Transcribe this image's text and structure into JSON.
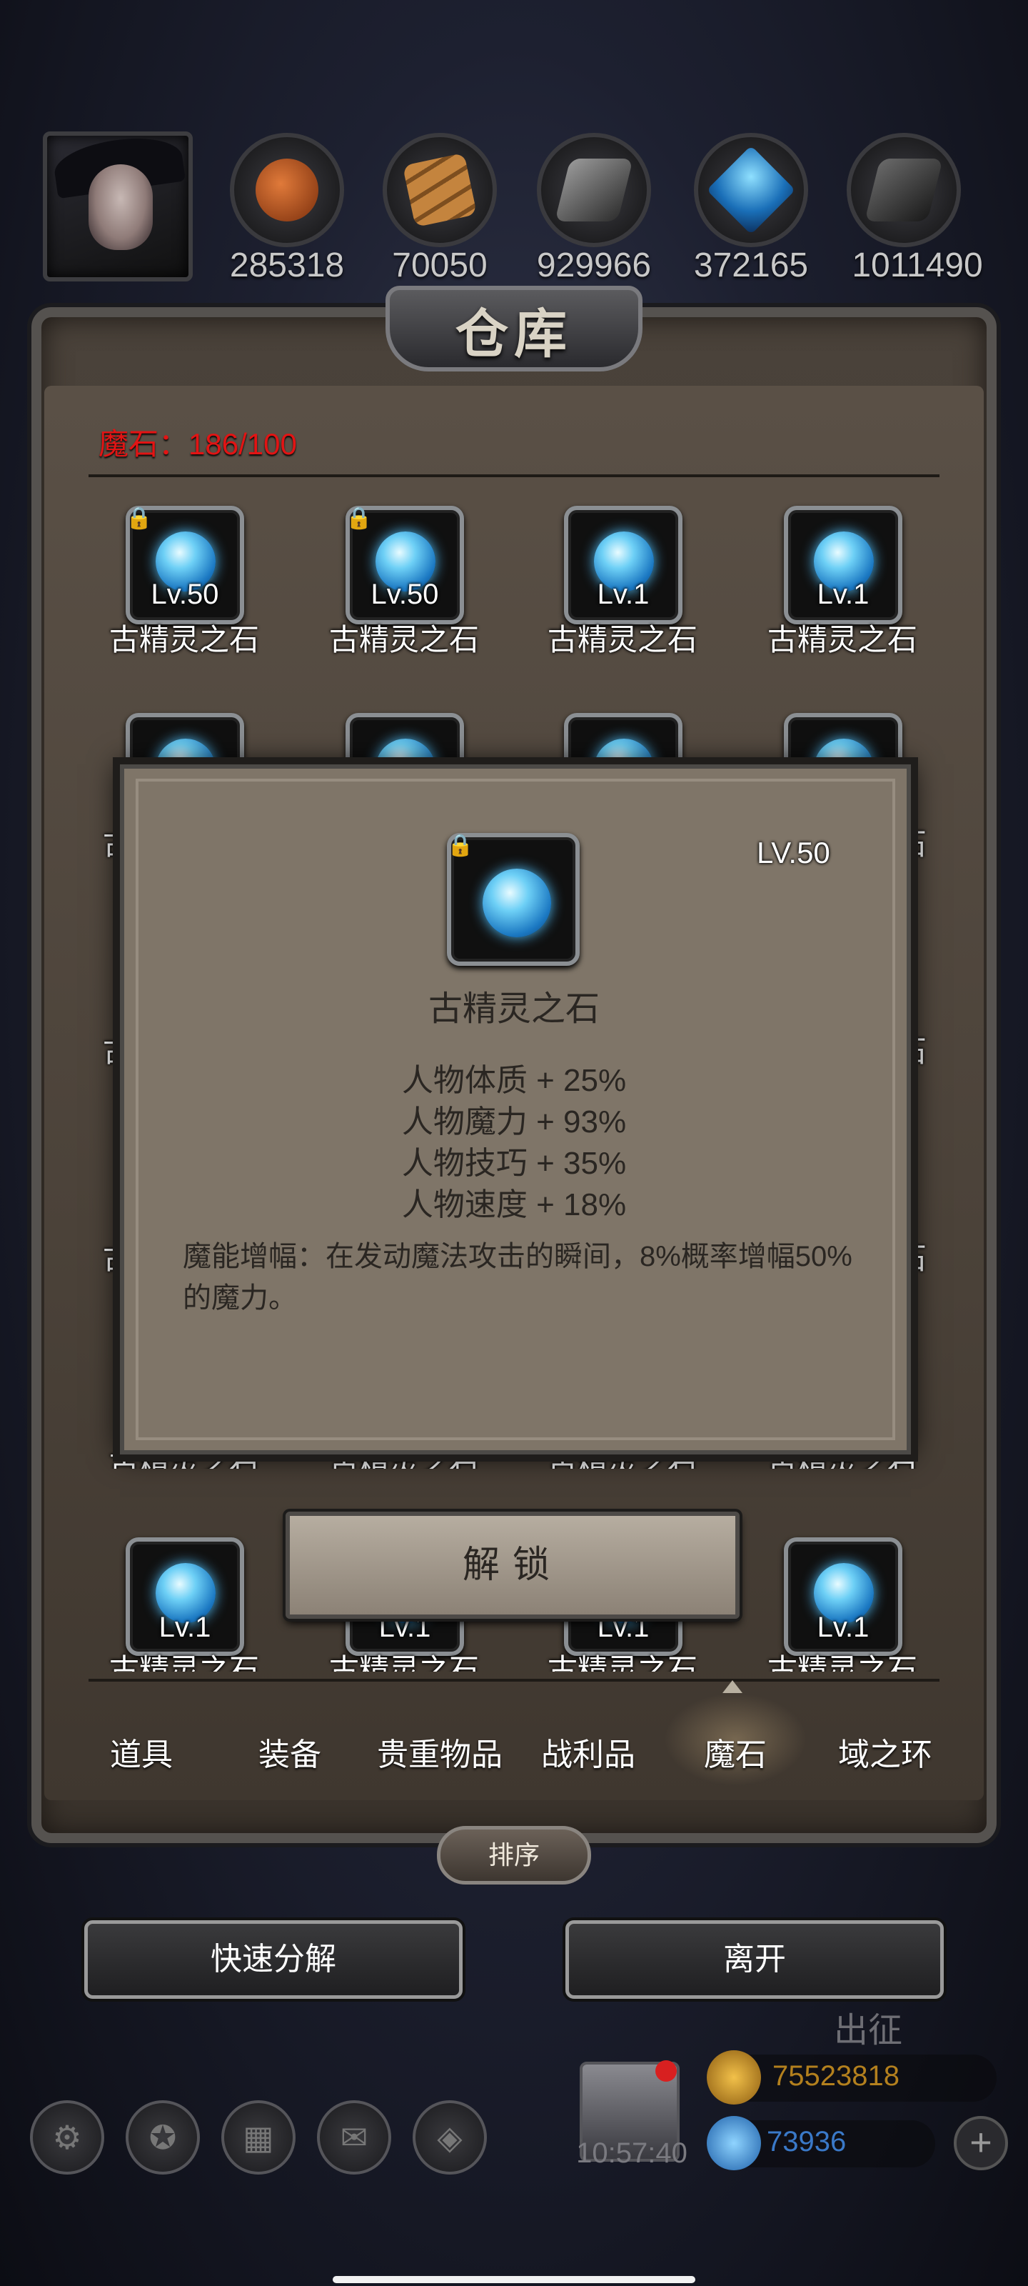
{
  "resources": [
    {
      "value": "285318",
      "icon": "meat-icon",
      "color": "#b3521c"
    },
    {
      "value": "70050",
      "icon": "wood-planks-icon",
      "color": "#a7692d"
    },
    {
      "value": "929966",
      "icon": "iron-ingot-icon",
      "color": "#585858"
    },
    {
      "value": "372165",
      "icon": "crystal-icon",
      "color": "#2d8fd6"
    },
    {
      "value": "1011490",
      "icon": "dark-ingot-icon",
      "color": "#404040"
    }
  ],
  "warehouse": {
    "title": "仓库",
    "stone_count": "魔石：186/100"
  },
  "grid": {
    "rows": [
      [
        {
          "level": "Lv.50",
          "name": "古精灵之石",
          "locked": true
        },
        {
          "level": "Lv.50",
          "name": "古精灵之石",
          "locked": true
        },
        {
          "level": "Lv.1",
          "name": "古精灵之石",
          "locked": false
        },
        {
          "level": "Lv.1",
          "name": "古精灵之石",
          "locked": false
        }
      ]
    ],
    "partial_names_right": "石",
    "partial_names_left": "古",
    "bottom_row": [
      {
        "level": "Lv.1",
        "name": "古精灵之石"
      },
      {
        "level": "Lv.1",
        "name": "古精灵之石"
      },
      {
        "level": "Lv.1",
        "name": "古精灵之石"
      },
      {
        "level": "Lv.1",
        "name": "古精灵之石"
      }
    ],
    "hidden_row_names": [
      "古精灵之石",
      "古精灵之石",
      "古精灵之石",
      "古精灵之石"
    ]
  },
  "tooltip": {
    "level": "LV.50",
    "name": "古精灵之石",
    "stats": [
      "人物体质 + 25%",
      "人物魔力 + 93%",
      "人物技巧 + 35%",
      "人物速度 + 18%"
    ],
    "description": "魔能增幅：在发动魔法攻击的瞬间，8%概率增幅50%的魔力。"
  },
  "unlock_button": "解锁",
  "tabs": [
    {
      "label": "道具",
      "active": false
    },
    {
      "label": "装备",
      "active": false
    },
    {
      "label": "贵重物品",
      "active": false
    },
    {
      "label": "战利品",
      "active": false
    },
    {
      "label": "魔石",
      "active": true
    },
    {
      "label": "域之环",
      "active": false
    }
  ],
  "sort_button": "排序",
  "quick_decompose_button": "快速分解",
  "leave_button": "离开",
  "hud": {
    "clock": "10:57:40",
    "gold": "75523818",
    "gems": "73936",
    "depart": "出征",
    "plus": "+"
  }
}
